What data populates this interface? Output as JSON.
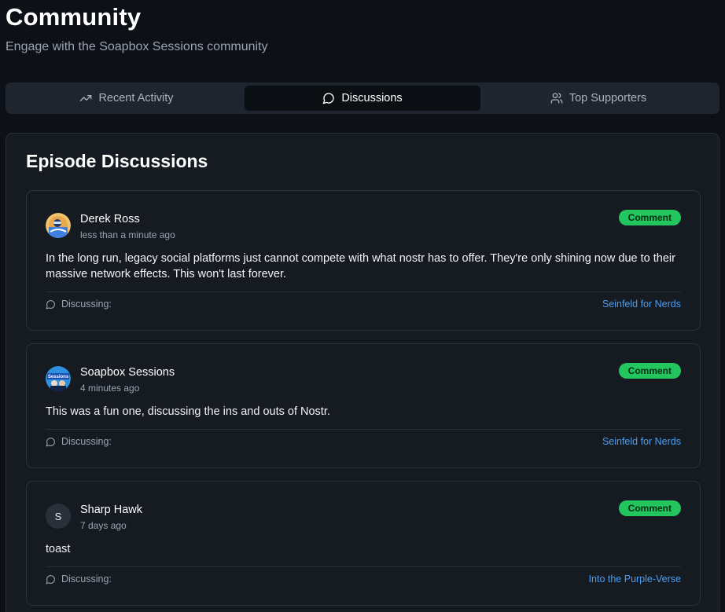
{
  "header": {
    "title": "Community",
    "subtitle": "Engage with the Soapbox Sessions community"
  },
  "tabs": [
    {
      "label": "Recent Activity",
      "icon": "trending-up-icon",
      "active": false
    },
    {
      "label": "Discussions",
      "icon": "message-circle-icon",
      "active": true
    },
    {
      "label": "Top Supporters",
      "icon": "users-icon",
      "active": false
    }
  ],
  "discussions": {
    "title": "Episode Discussions",
    "items": [
      {
        "author": "Derek Ross",
        "time": "less than a minute ago",
        "badge": "Comment",
        "content": "In the long run, legacy social platforms just cannot compete with what nostr has to offer. They're only shining now due to their massive network effects. This won't last forever.",
        "discussing_label": "Discussing:",
        "episode": "Seinfeld for Nerds",
        "avatar": "avatar-photo"
      },
      {
        "author": "Soapbox Sessions",
        "time": "4 minutes ago",
        "badge": "Comment",
        "content": "This was a fun one, discussing the ins and outs of Nostr.",
        "discussing_label": "Discussing:",
        "episode": "Seinfeld for Nerds",
        "avatar": "avatar-logo",
        "avatar_text": "Sessions"
      },
      {
        "author": "Sharp Hawk",
        "time": "7 days ago",
        "badge": "Comment",
        "content": "toast",
        "discussing_label": "Discussing:",
        "episode": "Into the Purple-Verse",
        "avatar": "avatar-letter",
        "avatar_letter": "S"
      }
    ]
  },
  "colors": {
    "background": "#0d1117",
    "panel": "#161b22",
    "badge": "#22c55e",
    "link": "#4b9df0"
  }
}
